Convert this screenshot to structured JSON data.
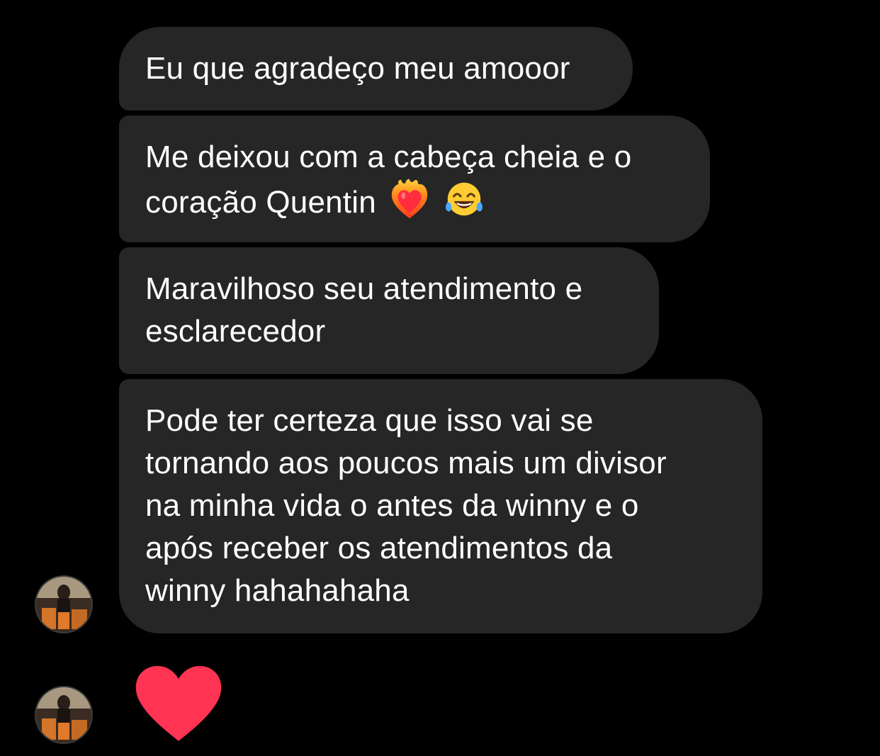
{
  "messages": [
    {
      "lines": [
        "Eu que agradeço meu amooor"
      ]
    },
    {
      "lines": [
        "Me deixou com a cabeça cheia e o",
        "coração Quentin"
      ],
      "emojis": [
        "heart-on-fire-emoji",
        "tears-of-joy-emoji"
      ]
    },
    {
      "lines": [
        "Maravilhoso seu atendimento e",
        "esclarecedor"
      ]
    },
    {
      "lines": [
        "Pode ter certeza que isso vai se",
        "tornando aos poucos mais um divisor",
        "na minha vida o antes da winny e o",
        "após receber os atendimentos da",
        "winny hahahahaha"
      ]
    }
  ],
  "reaction": {
    "icon": "heart-icon",
    "color": "#ff3352"
  },
  "colors": {
    "background": "#000000",
    "bubble": "#262626",
    "text": "#ffffff"
  }
}
